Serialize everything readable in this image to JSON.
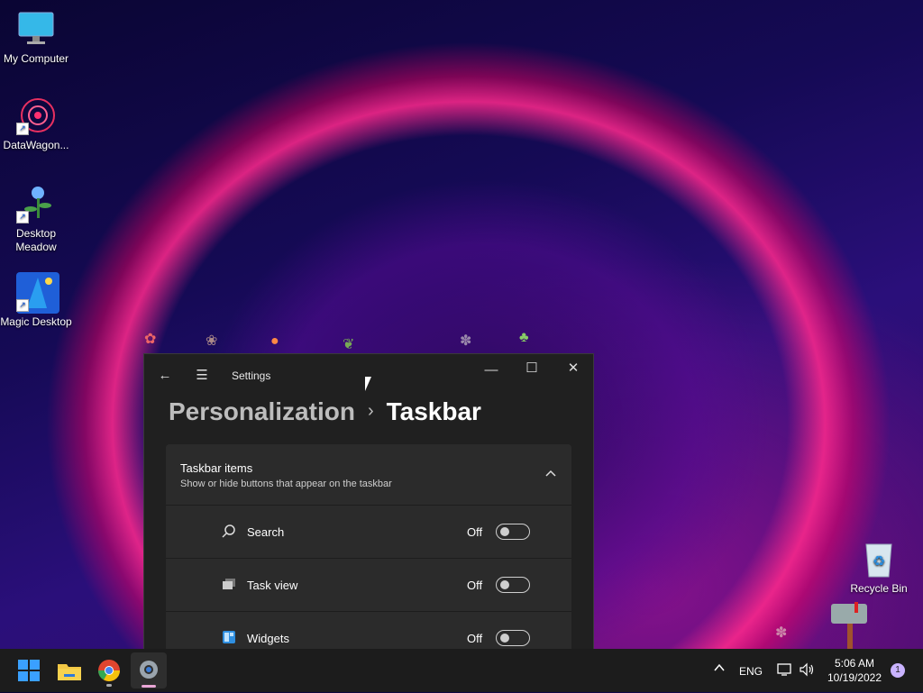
{
  "desktop": {
    "icons": [
      {
        "label": "My Computer",
        "icon": "monitor-icon",
        "shortcut": false
      },
      {
        "label": "DataWagon...",
        "icon": "mandala-icon",
        "shortcut": true
      },
      {
        "label": "Desktop Meadow",
        "icon": "flower-icon",
        "shortcut": true
      },
      {
        "label": "Magic Desktop",
        "icon": "wizard-icon",
        "shortcut": true
      },
      {
        "label": "Recycle Bin",
        "icon": "recycle-bin-icon",
        "shortcut": false
      }
    ]
  },
  "window": {
    "title": "Settings",
    "breadcrumb_parent": "Personalization",
    "breadcrumb_sep": "›",
    "breadcrumb_current": "Taskbar",
    "section": {
      "title": "Taskbar items",
      "subtitle": "Show or hide buttons that appear on the taskbar",
      "rows": [
        {
          "label": "Search",
          "state": "Off",
          "icon": "search-icon"
        },
        {
          "label": "Task view",
          "state": "Off",
          "icon": "task-view-icon"
        },
        {
          "label": "Widgets",
          "state": "Off",
          "icon": "widgets-icon"
        }
      ]
    },
    "controls": {
      "minimize": "—",
      "maximize": "☐",
      "close": "✕",
      "back": "←",
      "menu": "☰"
    }
  },
  "taskbar": {
    "apps": [
      "start-icon",
      "file-explorer-icon",
      "chrome-icon",
      "settings-icon"
    ],
    "language": "ENG",
    "time": "5:06 AM",
    "date": "10/19/2022",
    "notification_count": "1",
    "overflow_chevron": "^"
  },
  "colors": {
    "accent": "#0078d4",
    "window_bg": "#202020",
    "card_bg": "#2b2b2b"
  }
}
